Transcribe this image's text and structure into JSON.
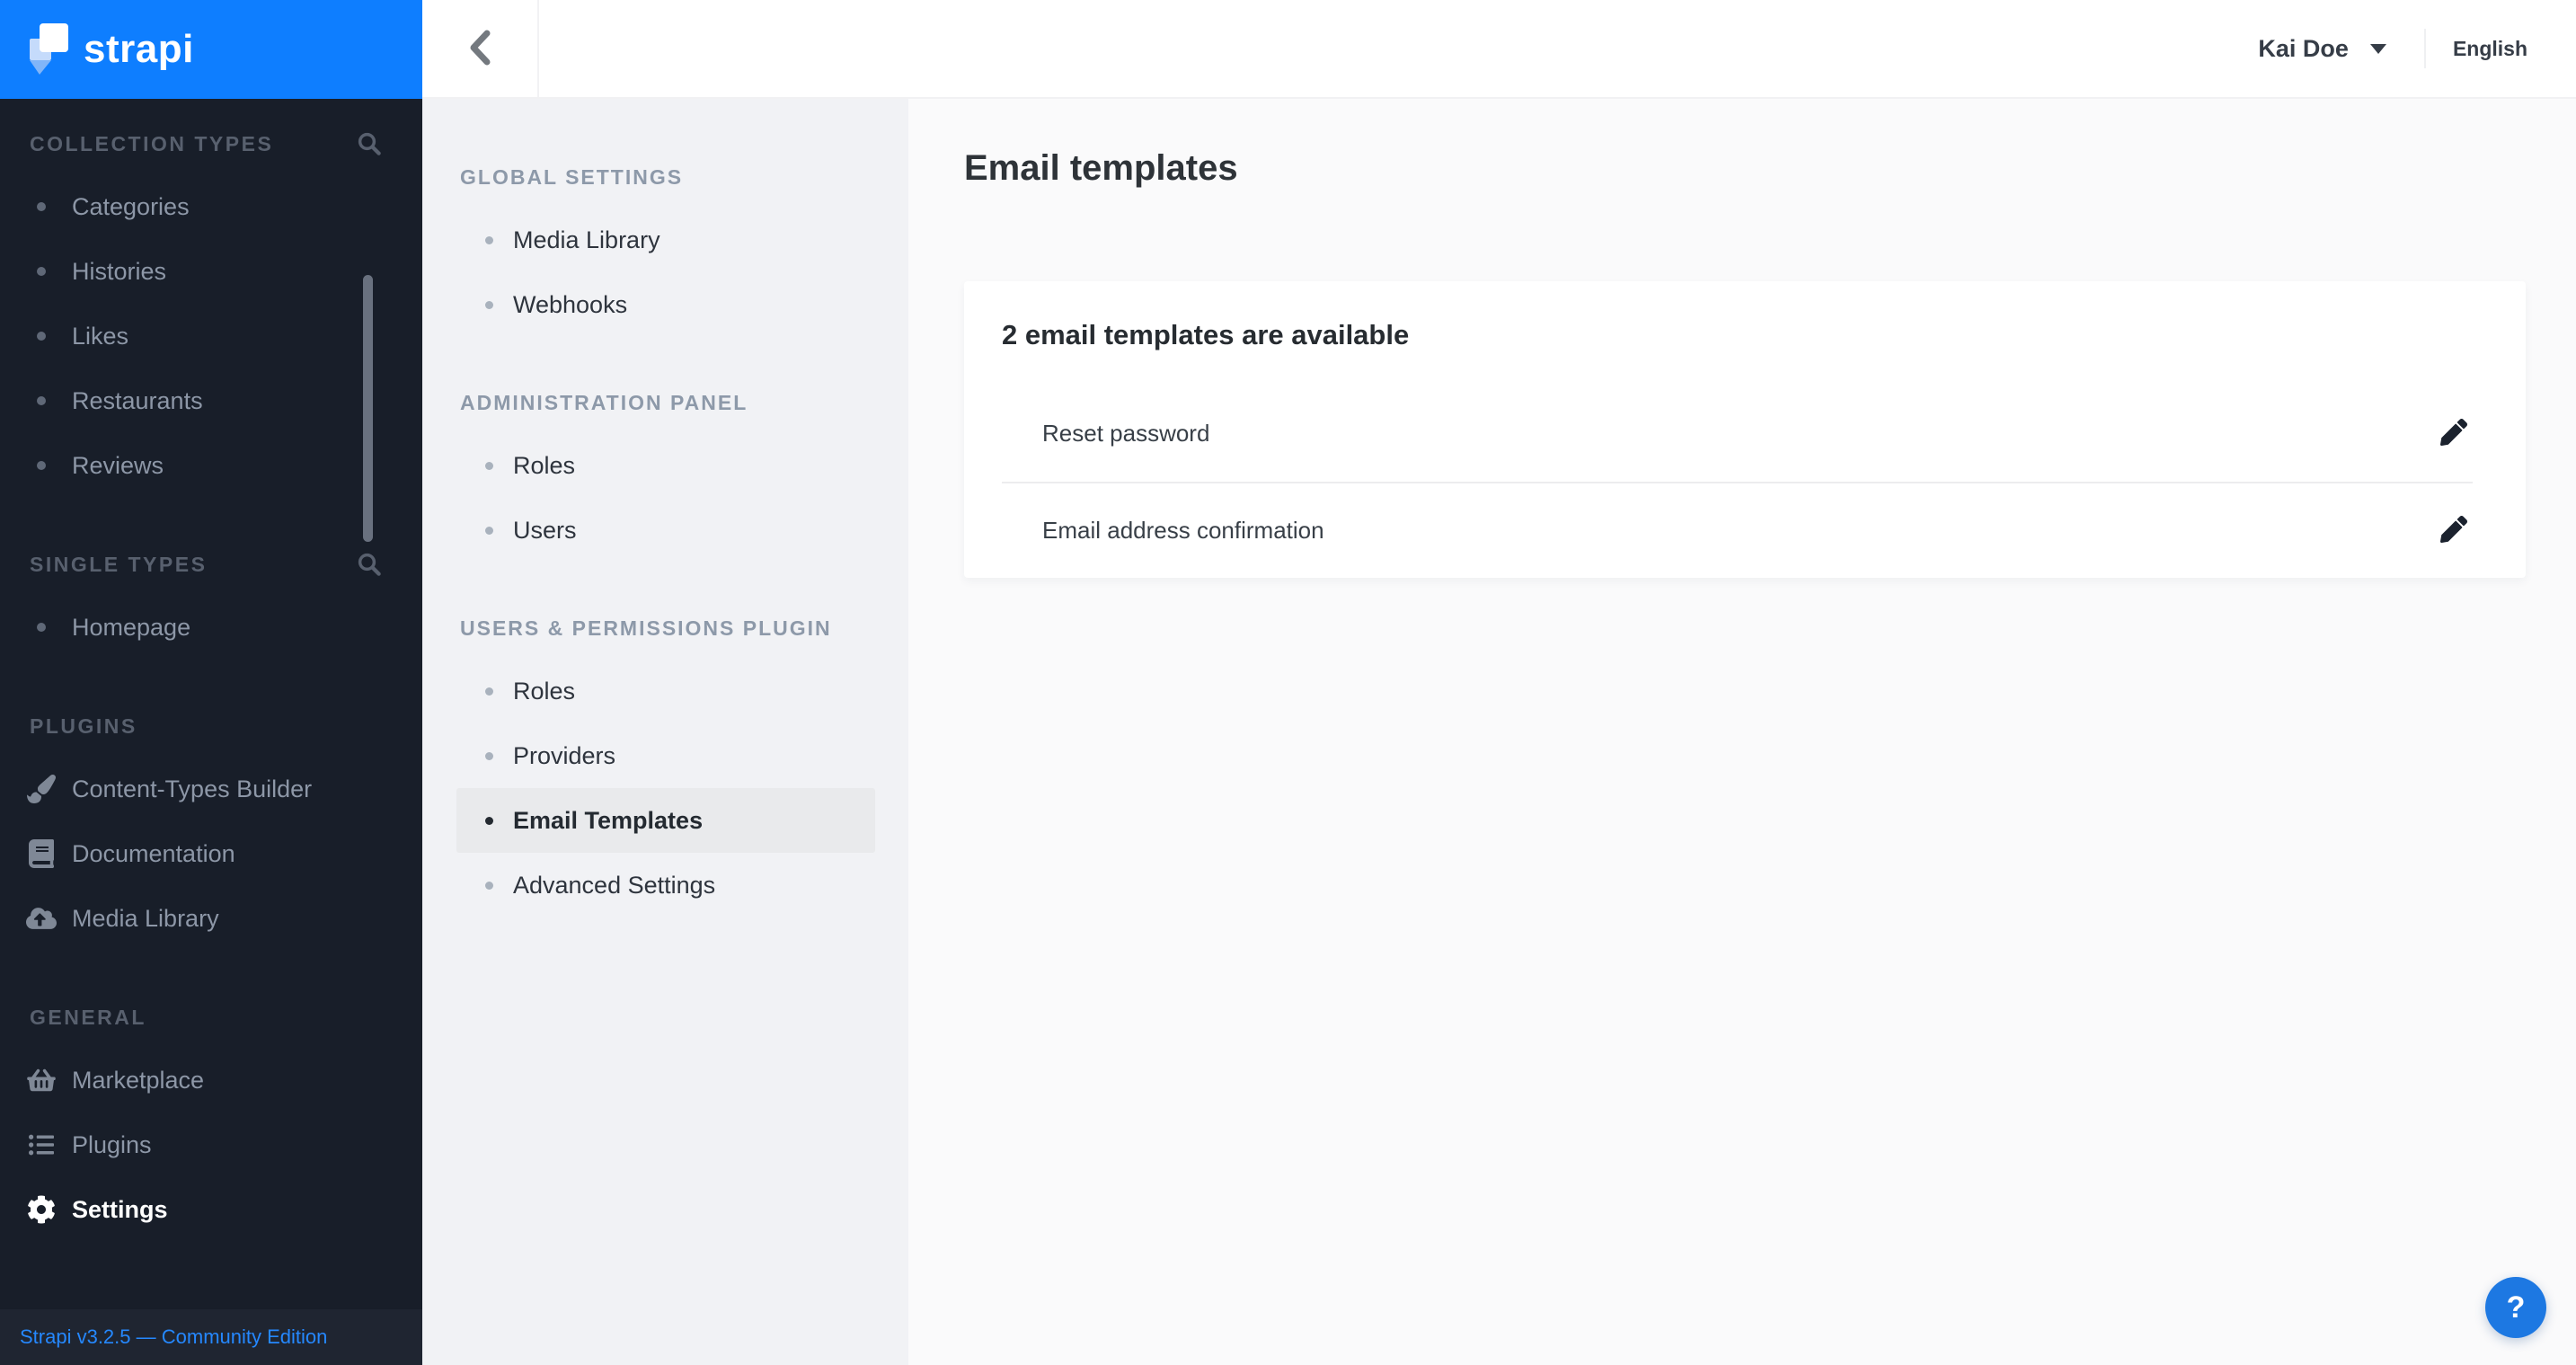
{
  "brand": {
    "logo_text": "strapi",
    "version_label": "Strapi v3.2.5 — Community Edition"
  },
  "colors": {
    "brand_blue": "#0e7eff",
    "sidebar_bg": "#181e29",
    "subnav_bg": "#f1f2f5",
    "main_bg": "#fafafb",
    "active_item_bg": "#e9eaec",
    "help_button_blue": "#1d78e2"
  },
  "left_sidebar": {
    "sections": [
      {
        "label": "COLLECTION TYPES",
        "has_search": true,
        "items": [
          {
            "label": "Categories"
          },
          {
            "label": "Histories"
          },
          {
            "label": "Likes"
          },
          {
            "label": "Restaurants"
          },
          {
            "label": "Reviews"
          }
        ]
      },
      {
        "label": "SINGLE TYPES",
        "has_search": true,
        "items": [
          {
            "label": "Homepage"
          }
        ]
      },
      {
        "label": "PLUGINS",
        "items": [
          {
            "label": "Content-Types Builder",
            "icon": "paint-brush-icon"
          },
          {
            "label": "Documentation",
            "icon": "book-icon"
          },
          {
            "label": "Media Library",
            "icon": "cloud-upload-icon"
          }
        ]
      },
      {
        "label": "GENERAL",
        "items": [
          {
            "label": "Marketplace",
            "icon": "basket-icon"
          },
          {
            "label": "Plugins",
            "icon": "list-icon"
          },
          {
            "label": "Settings",
            "icon": "gear-icon",
            "active": true
          }
        ]
      }
    ]
  },
  "topbar": {
    "user_name": "Kai Doe",
    "language": "English"
  },
  "settings_nav": {
    "sections": [
      {
        "label": "GLOBAL SETTINGS",
        "items": [
          {
            "label": "Media Library"
          },
          {
            "label": "Webhooks"
          }
        ]
      },
      {
        "label": "ADMINISTRATION PANEL",
        "items": [
          {
            "label": "Roles"
          },
          {
            "label": "Users"
          }
        ]
      },
      {
        "label": "USERS & PERMISSIONS PLUGIN",
        "active_item": "Email Templates",
        "items": [
          {
            "label": "Roles"
          },
          {
            "label": "Providers"
          },
          {
            "label": "Email Templates",
            "active": true
          },
          {
            "label": "Advanced Settings"
          }
        ]
      }
    ]
  },
  "main": {
    "title": "Email templates",
    "card": {
      "heading": "2 email templates are available",
      "rows": [
        {
          "label": "Reset password",
          "action": "edit"
        },
        {
          "label": "Email address confirmation",
          "action": "edit"
        }
      ]
    }
  },
  "help": {
    "label": "?"
  }
}
